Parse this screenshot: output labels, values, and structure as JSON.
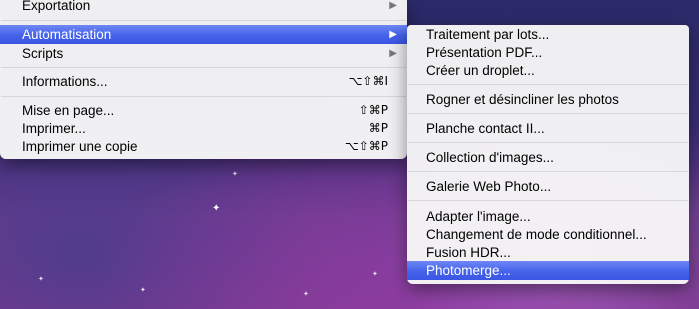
{
  "main_menu": {
    "items": [
      {
        "label": "Exportation",
        "submenu": true
      },
      {
        "label": "Automatisation",
        "submenu": true,
        "highlighted": true
      },
      {
        "label": "Scripts",
        "submenu": true
      },
      {
        "label": "Informations...",
        "shortcut": "⌥⇧⌘I"
      },
      {
        "label": "Mise en page...",
        "shortcut": "⇧⌘P"
      },
      {
        "label": "Imprimer...",
        "shortcut": "⌘P"
      },
      {
        "label": "Imprimer une copie",
        "shortcut": "⌥⇧⌘P"
      }
    ]
  },
  "sub_menu": {
    "items": [
      {
        "label": "Traitement par lots..."
      },
      {
        "label": "Présentation PDF..."
      },
      {
        "label": "Créer un droplet..."
      },
      {
        "label": "Rogner et désincliner les photos"
      },
      {
        "label": "Planche contact II..."
      },
      {
        "label": "Collection d'images..."
      },
      {
        "label": "Galerie Web Photo..."
      },
      {
        "label": "Adapter l'image..."
      },
      {
        "label": "Changement de mode conditionnel..."
      },
      {
        "label": "Fusion HDR..."
      },
      {
        "label": "Photomerge...",
        "highlighted": true
      }
    ]
  },
  "icons": {
    "submenu_arrow": "triangle-right-icon"
  },
  "colors": {
    "highlight": "#4462ea",
    "menu_background": "#f6f6f6"
  }
}
